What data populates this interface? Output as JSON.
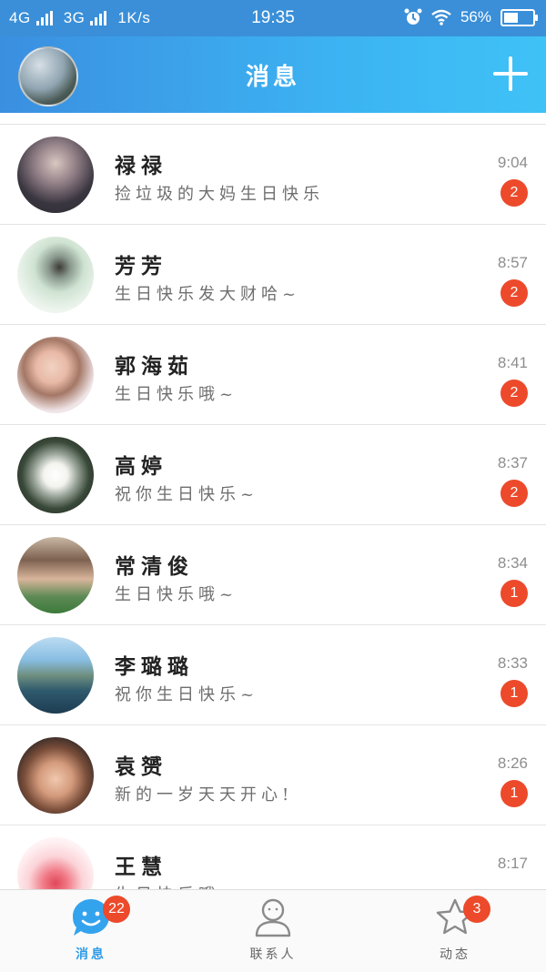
{
  "status_bar": {
    "network1": "4G",
    "network2": "3G",
    "speed": "1K/s",
    "time": "19:35",
    "battery": "56%",
    "battery_level": 0.56
  },
  "header": {
    "title": "消息"
  },
  "conversations": [
    {
      "name": "禄禄",
      "message": "捡垃圾的大妈生日快乐",
      "time": "9:04",
      "unread": "2"
    },
    {
      "name": "芳芳",
      "message": "生日快乐发大财哈~",
      "time": "8:57",
      "unread": "2"
    },
    {
      "name": "郭海茹",
      "message": "生日快乐哦~",
      "time": "8:41",
      "unread": "2"
    },
    {
      "name": "高婷",
      "message": "祝你生日快乐~",
      "time": "8:37",
      "unread": "2"
    },
    {
      "name": "常清俊",
      "message": "生日快乐哦~",
      "time": "8:34",
      "unread": "1"
    },
    {
      "name": "李璐璐",
      "message": "祝你生日快乐~",
      "time": "8:33",
      "unread": "1"
    },
    {
      "name": "袁赟",
      "message": "新的一岁天天开心!",
      "time": "8:26",
      "unread": "1"
    },
    {
      "name": "王慧",
      "message": "生日快乐哦",
      "time": "8:17",
      "unread": ""
    }
  ],
  "tabs": [
    {
      "label": "消息",
      "badge": "22",
      "icon": "chat-bubble-face-icon"
    },
    {
      "label": "联系人",
      "badge": "",
      "icon": "person-icon"
    },
    {
      "label": "动态",
      "badge": "3",
      "icon": "star-icon"
    }
  ],
  "colors": {
    "header_start": "#3b8fe0",
    "header_end": "#3fc2f6",
    "badge": "#ec4a2b",
    "active_tab": "#2f9be8"
  }
}
